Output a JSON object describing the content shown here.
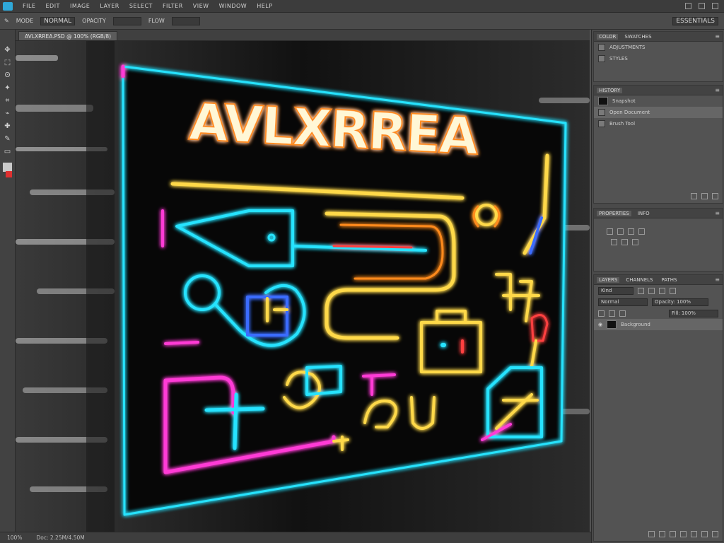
{
  "app": {
    "accent": "#2fa8d8"
  },
  "menu": {
    "items": [
      "FILE",
      "EDIT",
      "IMAGE",
      "LAYER",
      "SELECT",
      "FILTER",
      "VIEW",
      "WINDOW",
      "HELP"
    ]
  },
  "options": {
    "items": [
      "MODE",
      "NORMAL",
      "OPACITY",
      "FLOW"
    ],
    "right": [
      "ESSENTIALS"
    ]
  },
  "document": {
    "tab_label": "AVLXRREA.PSD @ 100% (RGB/8)"
  },
  "artwork": {
    "headline": "AVLXRREA",
    "colors": {
      "cyan": "#27e3ff",
      "yellow": "#ffd94a",
      "magenta": "#ff3bd6",
      "purple": "#9b5cff",
      "red": "#ff4040",
      "orange": "#ff8a1e"
    }
  },
  "status": {
    "zoom": "100%",
    "doc": "Doc: 2.25M/4.50M"
  },
  "panels": {
    "top": {
      "tabs": [
        "COLOR",
        "SWATCHES"
      ],
      "rows": [
        "ADJUSTMENTS",
        "STYLES"
      ]
    },
    "history": {
      "tabs": [
        "HISTORY"
      ],
      "rows": [
        "Snapshot",
        "Open Document",
        "Brush Tool"
      ]
    },
    "properties": {
      "tabs": [
        "PROPERTIES",
        "INFO"
      ]
    },
    "layers": {
      "tabs": [
        "LAYERS",
        "CHANNELS",
        "PATHS"
      ],
      "kind_label": "Kind",
      "blend": "Normal",
      "opacity": "Opacity: 100%",
      "fill": "Fill: 100%",
      "layer_name": "Background"
    }
  }
}
